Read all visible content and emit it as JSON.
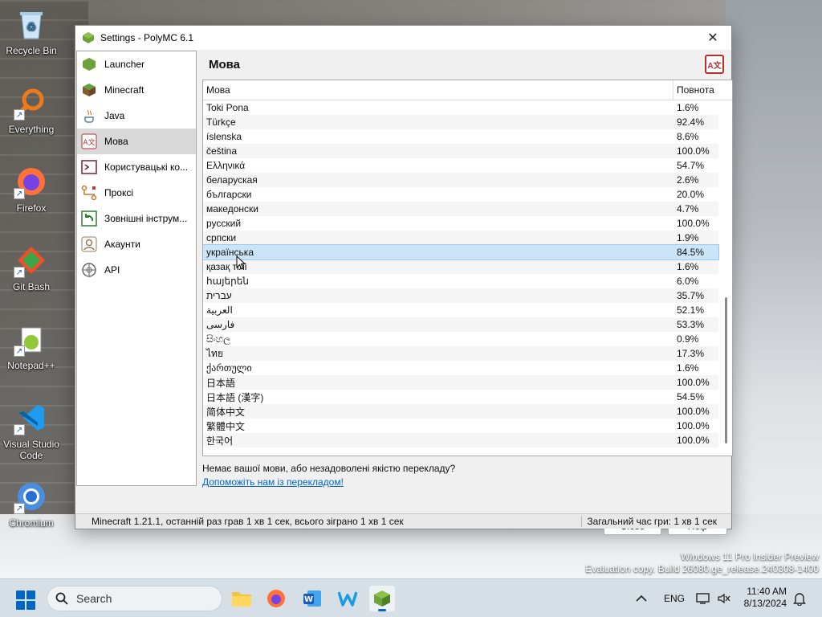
{
  "desktop": {
    "icons": [
      {
        "label": "Recycle Bin"
      },
      {
        "label": "Everything"
      },
      {
        "label": "Firefox"
      },
      {
        "label": "Git Bash"
      },
      {
        "label": "Notepad++"
      },
      {
        "label": "Visual Studio Code"
      },
      {
        "label": "Chromium"
      }
    ],
    "watermark_line1": "Windows 11 Pro Insider Preview",
    "watermark_line2": "Evaluation copy. Build 26080.ge_release.240308-1400"
  },
  "window": {
    "title": "Settings - PolyMC 6.1",
    "sidebar": [
      {
        "label": "Launcher",
        "icon": "launcher-icon"
      },
      {
        "label": "Minecraft",
        "icon": "minecraft-icon"
      },
      {
        "label": "Java",
        "icon": "java-icon"
      },
      {
        "label": "Мова",
        "icon": "language-icon",
        "active": true
      },
      {
        "label": "Користувацькі ко...",
        "icon": "custom-commands-icon"
      },
      {
        "label": "Проксі",
        "icon": "proxy-icon"
      },
      {
        "label": "Зовнішні інструм...",
        "icon": "external-tools-icon"
      },
      {
        "label": "Акаунти",
        "icon": "accounts-icon"
      },
      {
        "label": "API",
        "icon": "api-icon"
      }
    ],
    "page_heading": "Мова",
    "table": {
      "col_language": "Мова",
      "col_completeness": "Повнота",
      "rows": [
        {
          "lang": "Toki Pona",
          "pct": "1.6%"
        },
        {
          "lang": "Türkçe",
          "pct": "92.4%"
        },
        {
          "lang": "íslenska",
          "pct": "8.6%"
        },
        {
          "lang": "čeština",
          "pct": "100.0%"
        },
        {
          "lang": "Ελληνικά",
          "pct": "54.7%"
        },
        {
          "lang": "беларуская",
          "pct": "2.6%"
        },
        {
          "lang": "български",
          "pct": "20.0%"
        },
        {
          "lang": "македонски",
          "pct": "4.7%"
        },
        {
          "lang": "русский",
          "pct": "100.0%"
        },
        {
          "lang": "српски",
          "pct": "1.9%"
        },
        {
          "lang": "українська",
          "pct": "84.5%",
          "selected": true
        },
        {
          "lang": "қазақ тілі",
          "pct": "1.6%"
        },
        {
          "lang": "հայերեն",
          "pct": "6.0%"
        },
        {
          "lang": "עברית",
          "pct": "35.7%"
        },
        {
          "lang": "العربية",
          "pct": "52.1%"
        },
        {
          "lang": "فارسی",
          "pct": "53.3%"
        },
        {
          "lang": "සිංහල",
          "pct": "0.9%"
        },
        {
          "lang": "ไทย",
          "pct": "17.3%"
        },
        {
          "lang": "ქართული",
          "pct": "1.6%"
        },
        {
          "lang": "日本語",
          "pct": "100.0%"
        },
        {
          "lang": "日本語 (漢字)",
          "pct": "54.5%"
        },
        {
          "lang": "简体中文",
          "pct": "100.0%"
        },
        {
          "lang": "繁體中文",
          "pct": "100.0%"
        },
        {
          "lang": "한국어",
          "pct": "100.0%"
        }
      ]
    },
    "hint_text": "Немає вашої мови, або незадоволені якістю перекладу?",
    "hint_link": "Допоможіть нам із перекладом!",
    "close_button": "Close",
    "help_button": "Help",
    "status_left": "Minecraft 1.21.1, останній раз грав 1 хв 1 сек, всього зіграно 1 хв 1 сек",
    "status_right": "Загальний час гри: 1 хв 1 сек"
  },
  "taskbar": {
    "search_placeholder": "Search",
    "language": "ENG",
    "time": "11:40 AM",
    "date": "8/13/2024"
  }
}
